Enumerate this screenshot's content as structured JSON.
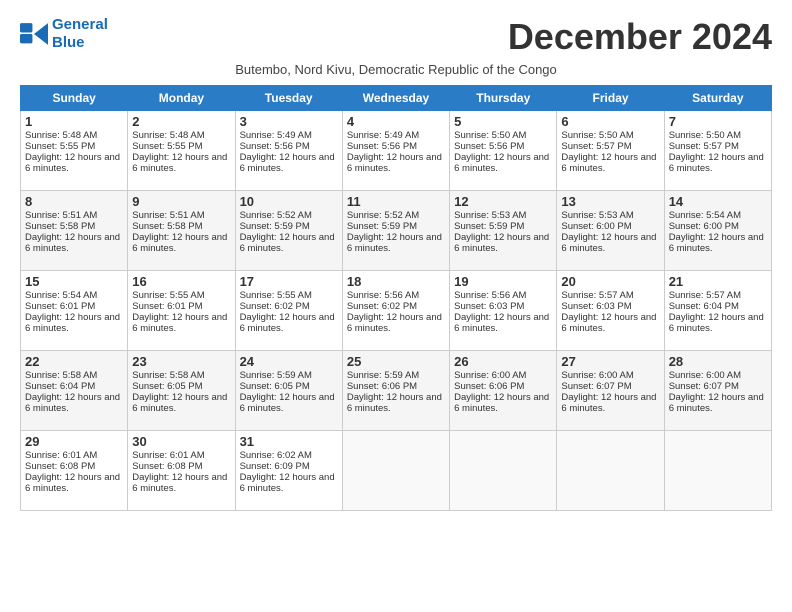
{
  "logo": {
    "line1": "General",
    "line2": "Blue"
  },
  "title": "December 2024",
  "subtitle": "Butembo, Nord Kivu, Democratic Republic of the Congo",
  "days_of_week": [
    "Sunday",
    "Monday",
    "Tuesday",
    "Wednesday",
    "Thursday",
    "Friday",
    "Saturday"
  ],
  "weeks": [
    [
      {
        "day": "1",
        "sunrise": "Sunrise: 5:48 AM",
        "sunset": "Sunset: 5:55 PM",
        "daylight": "Daylight: 12 hours and 6 minutes."
      },
      {
        "day": "2",
        "sunrise": "Sunrise: 5:48 AM",
        "sunset": "Sunset: 5:55 PM",
        "daylight": "Daylight: 12 hours and 6 minutes."
      },
      {
        "day": "3",
        "sunrise": "Sunrise: 5:49 AM",
        "sunset": "Sunset: 5:56 PM",
        "daylight": "Daylight: 12 hours and 6 minutes."
      },
      {
        "day": "4",
        "sunrise": "Sunrise: 5:49 AM",
        "sunset": "Sunset: 5:56 PM",
        "daylight": "Daylight: 12 hours and 6 minutes."
      },
      {
        "day": "5",
        "sunrise": "Sunrise: 5:50 AM",
        "sunset": "Sunset: 5:56 PM",
        "daylight": "Daylight: 12 hours and 6 minutes."
      },
      {
        "day": "6",
        "sunrise": "Sunrise: 5:50 AM",
        "sunset": "Sunset: 5:57 PM",
        "daylight": "Daylight: 12 hours and 6 minutes."
      },
      {
        "day": "7",
        "sunrise": "Sunrise: 5:50 AM",
        "sunset": "Sunset: 5:57 PM",
        "daylight": "Daylight: 12 hours and 6 minutes."
      }
    ],
    [
      {
        "day": "8",
        "sunrise": "Sunrise: 5:51 AM",
        "sunset": "Sunset: 5:58 PM",
        "daylight": "Daylight: 12 hours and 6 minutes."
      },
      {
        "day": "9",
        "sunrise": "Sunrise: 5:51 AM",
        "sunset": "Sunset: 5:58 PM",
        "daylight": "Daylight: 12 hours and 6 minutes."
      },
      {
        "day": "10",
        "sunrise": "Sunrise: 5:52 AM",
        "sunset": "Sunset: 5:59 PM",
        "daylight": "Daylight: 12 hours and 6 minutes."
      },
      {
        "day": "11",
        "sunrise": "Sunrise: 5:52 AM",
        "sunset": "Sunset: 5:59 PM",
        "daylight": "Daylight: 12 hours and 6 minutes."
      },
      {
        "day": "12",
        "sunrise": "Sunrise: 5:53 AM",
        "sunset": "Sunset: 5:59 PM",
        "daylight": "Daylight: 12 hours and 6 minutes."
      },
      {
        "day": "13",
        "sunrise": "Sunrise: 5:53 AM",
        "sunset": "Sunset: 6:00 PM",
        "daylight": "Daylight: 12 hours and 6 minutes."
      },
      {
        "day": "14",
        "sunrise": "Sunrise: 5:54 AM",
        "sunset": "Sunset: 6:00 PM",
        "daylight": "Daylight: 12 hours and 6 minutes."
      }
    ],
    [
      {
        "day": "15",
        "sunrise": "Sunrise: 5:54 AM",
        "sunset": "Sunset: 6:01 PM",
        "daylight": "Daylight: 12 hours and 6 minutes."
      },
      {
        "day": "16",
        "sunrise": "Sunrise: 5:55 AM",
        "sunset": "Sunset: 6:01 PM",
        "daylight": "Daylight: 12 hours and 6 minutes."
      },
      {
        "day": "17",
        "sunrise": "Sunrise: 5:55 AM",
        "sunset": "Sunset: 6:02 PM",
        "daylight": "Daylight: 12 hours and 6 minutes."
      },
      {
        "day": "18",
        "sunrise": "Sunrise: 5:56 AM",
        "sunset": "Sunset: 6:02 PM",
        "daylight": "Daylight: 12 hours and 6 minutes."
      },
      {
        "day": "19",
        "sunrise": "Sunrise: 5:56 AM",
        "sunset": "Sunset: 6:03 PM",
        "daylight": "Daylight: 12 hours and 6 minutes."
      },
      {
        "day": "20",
        "sunrise": "Sunrise: 5:57 AM",
        "sunset": "Sunset: 6:03 PM",
        "daylight": "Daylight: 12 hours and 6 minutes."
      },
      {
        "day": "21",
        "sunrise": "Sunrise: 5:57 AM",
        "sunset": "Sunset: 6:04 PM",
        "daylight": "Daylight: 12 hours and 6 minutes."
      }
    ],
    [
      {
        "day": "22",
        "sunrise": "Sunrise: 5:58 AM",
        "sunset": "Sunset: 6:04 PM",
        "daylight": "Daylight: 12 hours and 6 minutes."
      },
      {
        "day": "23",
        "sunrise": "Sunrise: 5:58 AM",
        "sunset": "Sunset: 6:05 PM",
        "daylight": "Daylight: 12 hours and 6 minutes."
      },
      {
        "day": "24",
        "sunrise": "Sunrise: 5:59 AM",
        "sunset": "Sunset: 6:05 PM",
        "daylight": "Daylight: 12 hours and 6 minutes."
      },
      {
        "day": "25",
        "sunrise": "Sunrise: 5:59 AM",
        "sunset": "Sunset: 6:06 PM",
        "daylight": "Daylight: 12 hours and 6 minutes."
      },
      {
        "day": "26",
        "sunrise": "Sunrise: 6:00 AM",
        "sunset": "Sunset: 6:06 PM",
        "daylight": "Daylight: 12 hours and 6 minutes."
      },
      {
        "day": "27",
        "sunrise": "Sunrise: 6:00 AM",
        "sunset": "Sunset: 6:07 PM",
        "daylight": "Daylight: 12 hours and 6 minutes."
      },
      {
        "day": "28",
        "sunrise": "Sunrise: 6:00 AM",
        "sunset": "Sunset: 6:07 PM",
        "daylight": "Daylight: 12 hours and 6 minutes."
      }
    ],
    [
      {
        "day": "29",
        "sunrise": "Sunrise: 6:01 AM",
        "sunset": "Sunset: 6:08 PM",
        "daylight": "Daylight: 12 hours and 6 minutes."
      },
      {
        "day": "30",
        "sunrise": "Sunrise: 6:01 AM",
        "sunset": "Sunset: 6:08 PM",
        "daylight": "Daylight: 12 hours and 6 minutes."
      },
      {
        "day": "31",
        "sunrise": "Sunrise: 6:02 AM",
        "sunset": "Sunset: 6:09 PM",
        "daylight": "Daylight: 12 hours and 6 minutes."
      },
      null,
      null,
      null,
      null
    ]
  ]
}
